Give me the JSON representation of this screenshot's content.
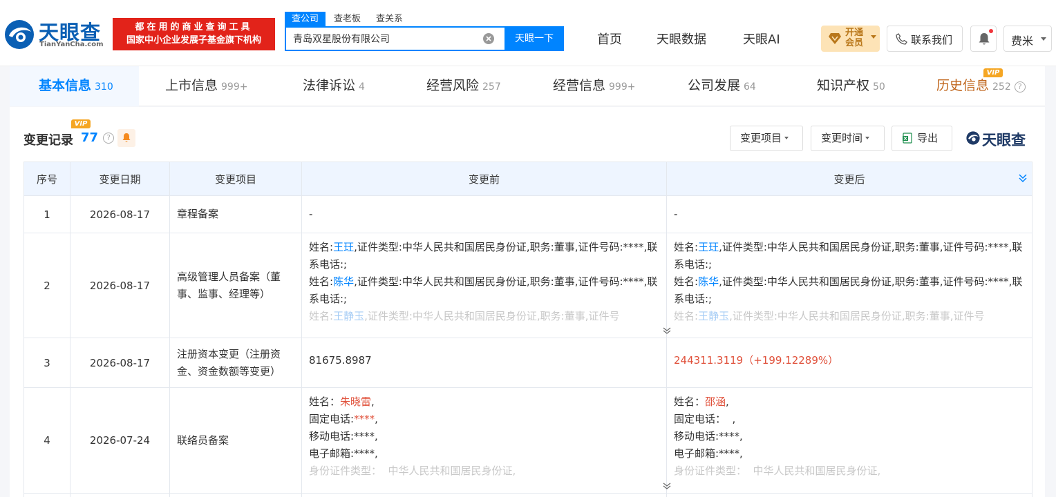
{
  "header": {
    "logo_cn": "天眼查",
    "logo_en": "TianYanCha.com",
    "banner_line1": "都在用的商业查询工具",
    "banner_line2": "国家中小企业发展子基金旗下机构",
    "search_tabs": [
      "查公司",
      "查老板",
      "查关系"
    ],
    "search_value": "青岛双星股份有限公司",
    "search_button": "天眼一下",
    "nav": [
      "首页",
      "天眼数据",
      "天眼AI"
    ],
    "vip_line1": "开通",
    "vip_line2": "会员",
    "contact": "联系我们",
    "user": "费米"
  },
  "tabs": [
    {
      "label": "基本信息",
      "count": "310"
    },
    {
      "label": "上市信息",
      "count": "999+"
    },
    {
      "label": "法律诉讼",
      "count": "4"
    },
    {
      "label": "经营风险",
      "count": "257"
    },
    {
      "label": "经营信息",
      "count": "999+"
    },
    {
      "label": "公司发展",
      "count": "64"
    },
    {
      "label": "知识产权",
      "count": "50"
    },
    {
      "label": "历史信息",
      "count": "252",
      "vip": "VIP"
    }
  ],
  "section": {
    "title": "变更记录",
    "count": "77",
    "vip": "VIP",
    "filter_item": "变更项目",
    "filter_time": "变更时间",
    "export": "导出",
    "watermark": "天眼查"
  },
  "table": {
    "headers": [
      "序号",
      "变更日期",
      "变更项目",
      "变更前",
      "变更后"
    ],
    "rows": [
      {
        "no": "1",
        "date": "2026-08-17",
        "item": "章程备案",
        "before": "-",
        "after": "-"
      },
      {
        "no": "2",
        "date": "2026-08-17",
        "item": "高级管理人员备案（董事、监事、经理等）",
        "before": {
          "p1_pre": "姓名:",
          "p1_name": "王玨",
          "p1_post": ",证件类型:中华人民共和国居民身份证,职务:董事,证件号码:****,联系电话:;",
          "p2_pre": "姓名:",
          "p2_name": "陈华",
          "p2_post": ",证件类型:中华人民共和国居民身份证,职务:董事,证件号码:****,联系电话:;",
          "p3_pre": "姓名:",
          "p3_name": "王静玉",
          "p3_post": ",证件类型:中华人民共和国居民身份证,职务:董事,证件号"
        },
        "after": {
          "p1_pre": "姓名:",
          "p1_name": "王玨",
          "p1_post": ",证件类型:中华人民共和国居民身份证,职务:董事,证件号码:****,联系电话:;",
          "p2_pre": "姓名:",
          "p2_name": "陈华",
          "p2_post": ",证件类型:中华人民共和国居民身份证,职务:董事,证件号码:****,联系电话:;",
          "p3_pre": "姓名:",
          "p3_name": "王静玉",
          "p3_post": ",证件类型:中华人民共和国居民身份证,职务:董事,证件号"
        }
      },
      {
        "no": "3",
        "date": "2026-08-17",
        "item": "注册资本变更（注册资金、资金数额等变更）",
        "before": "81675.8987",
        "after": "244311.3119（+199.12289%）"
      },
      {
        "no": "4",
        "date": "2026-07-24",
        "item": "联络员备案",
        "before": {
          "name_label": "姓名：",
          "name": "朱晓雷",
          "name_tail": ",",
          "phone_label": "固定电话:",
          "phone": "****",
          "phone_tail": ",",
          "mobile": "移动电话:****,",
          "email": "电子邮箱:****,",
          "id_type": "身份证件类型：  中华人民共和国居民身份证,"
        },
        "after": {
          "name_label": "姓名：",
          "name": "邵涵",
          "name_tail": ",",
          "phone": "固定电话：  ,",
          "mobile": "移动电话:****,",
          "email": "电子邮箱:****,",
          "id_type": "身份证件类型：  中华人民共和国居民身份证,"
        }
      }
    ]
  },
  "colors": {
    "accent": "#0084ff",
    "banner": "#e2231a",
    "change_red": "#e0503a",
    "history": "#c0651b",
    "vip": "#f5a623"
  }
}
